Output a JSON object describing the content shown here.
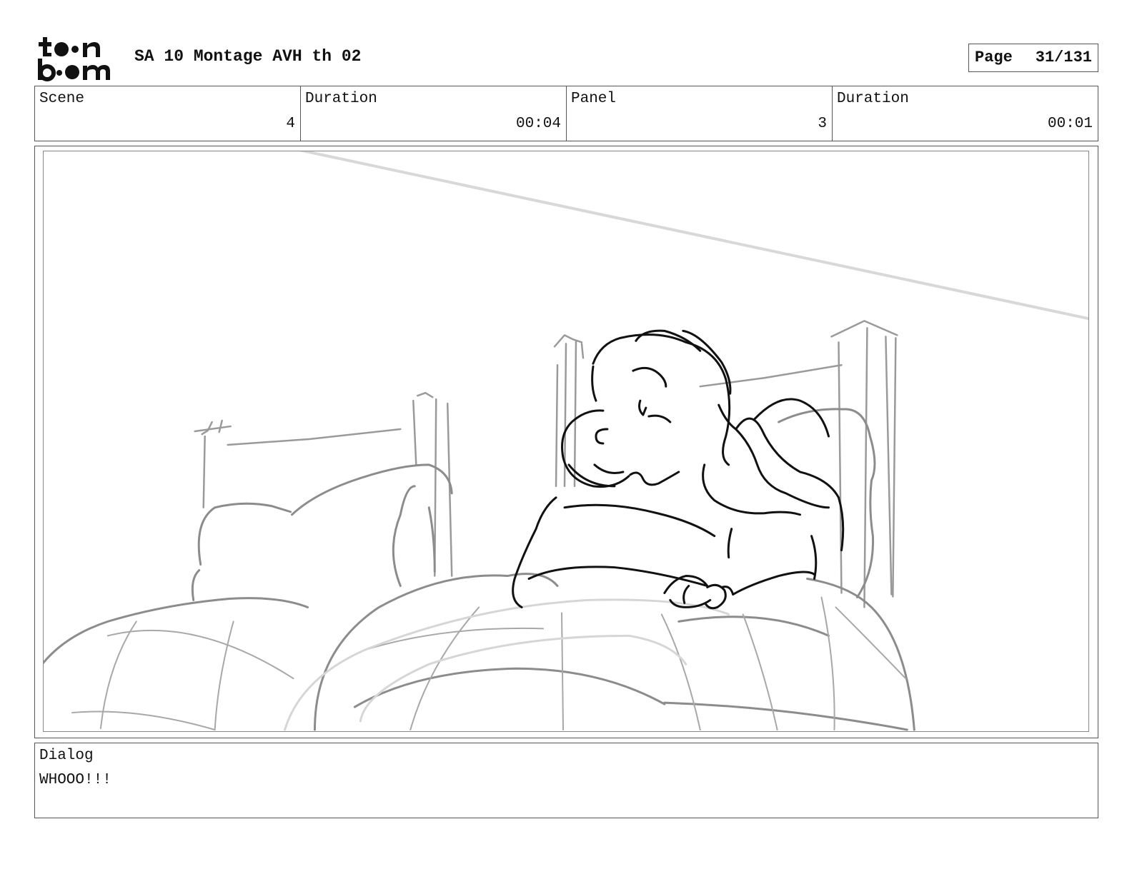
{
  "header": {
    "logo_text": "toon boom",
    "project_title": "SA 10 Montage AVH th 02",
    "page_label": "Page",
    "page_number": "31/131"
  },
  "info": {
    "scene_label": "Scene",
    "scene_value": "4",
    "scene_duration_label": "Duration",
    "scene_duration_value": "00:04",
    "panel_label": "Panel",
    "panel_value": "3",
    "panel_duration_label": "Duration",
    "panel_duration_value": "00:01"
  },
  "dialog": {
    "label": "Dialog",
    "text": "WHOOO!!!"
  }
}
